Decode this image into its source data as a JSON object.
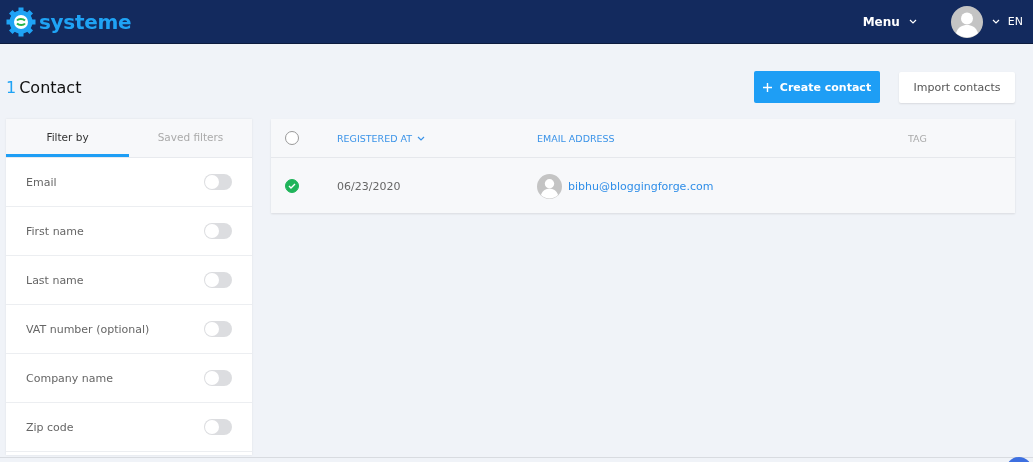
{
  "header": {
    "logo": "systeme",
    "menu": "Menu",
    "language": "EN"
  },
  "page": {
    "count": "1",
    "title": "Contact",
    "create_button": "Create contact",
    "import_button": "Import contacts"
  },
  "sidebar": {
    "tabs": [
      {
        "label": "Filter by",
        "selected": true
      },
      {
        "label": "Saved filters",
        "selected": false
      }
    ],
    "filters": [
      {
        "label": "Email",
        "on": false
      },
      {
        "label": "First name",
        "on": false
      },
      {
        "label": "Last name",
        "on": false
      },
      {
        "label": "VAT number (optional)",
        "on": false
      },
      {
        "label": "Company name",
        "on": false
      },
      {
        "label": "Zip code",
        "on": false
      }
    ]
  },
  "table": {
    "all_checked": false,
    "columns": [
      {
        "label": "REGISTERED AT",
        "sortable": true,
        "accent": true
      },
      {
        "label": "EMAIL ADDRESS",
        "sortable": false,
        "accent": true
      },
      {
        "label": "TAG",
        "sortable": false,
        "accent": false
      }
    ],
    "rows": [
      {
        "checked": true,
        "registered_at": "06/23/2020",
        "email": "bibhu@bloggingforge.com"
      }
    ]
  }
}
